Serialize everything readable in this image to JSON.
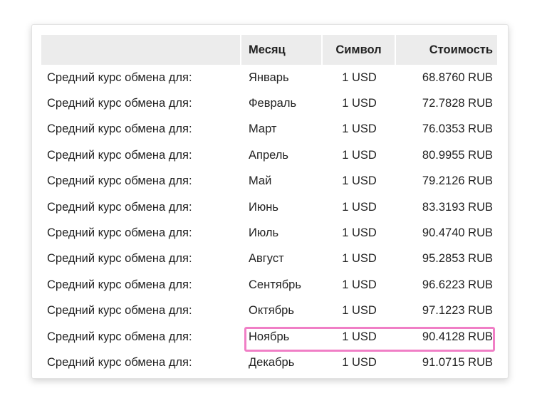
{
  "table": {
    "headers": {
      "description": "",
      "month": "Месяц",
      "symbol": "Символ",
      "cost": "Стоимость"
    },
    "rows": [
      {
        "description": "Средний курс обмена для:",
        "month": "Январь",
        "symbol": "1 USD",
        "cost": "68.8760 RUB"
      },
      {
        "description": "Средний курс обмена для:",
        "month": "Февраль",
        "symbol": "1 USD",
        "cost": "72.7828 RUB"
      },
      {
        "description": "Средний курс обмена для:",
        "month": "Март",
        "symbol": "1 USD",
        "cost": "76.0353 RUB"
      },
      {
        "description": "Средний курс обмена для:",
        "month": "Апрель",
        "symbol": "1 USD",
        "cost": "80.9955 RUB"
      },
      {
        "description": "Средний курс обмена для:",
        "month": "Май",
        "symbol": "1 USD",
        "cost": "79.2126 RUB"
      },
      {
        "description": "Средний курс обмена для:",
        "month": "Июнь",
        "symbol": "1 USD",
        "cost": "83.3193 RUB"
      },
      {
        "description": "Средний курс обмена для:",
        "month": "Июль",
        "symbol": "1 USD",
        "cost": "90.4740 RUB"
      },
      {
        "description": "Средний курс обмена для:",
        "month": "Август",
        "symbol": "1 USD",
        "cost": "95.2853 RUB"
      },
      {
        "description": "Средний курс обмена для:",
        "month": "Сентябрь",
        "symbol": "1 USD",
        "cost": "96.6223 RUB"
      },
      {
        "description": "Средний курс обмена для:",
        "month": "Октябрь",
        "symbol": "1 USD",
        "cost": "97.1223 RUB"
      },
      {
        "description": "Средний курс обмена для:",
        "month": "Ноябрь",
        "symbol": "1 USD",
        "cost": "90.4128 RUB"
      },
      {
        "description": "Средний курс обмена для:",
        "month": "Декабрь",
        "symbol": "1 USD",
        "cost": "91.0715 RUB"
      }
    ],
    "highlighted_row_index": 10
  },
  "colors": {
    "header_background": "#ececec",
    "highlight_border": "#f07fc6",
    "text": "#222222"
  }
}
